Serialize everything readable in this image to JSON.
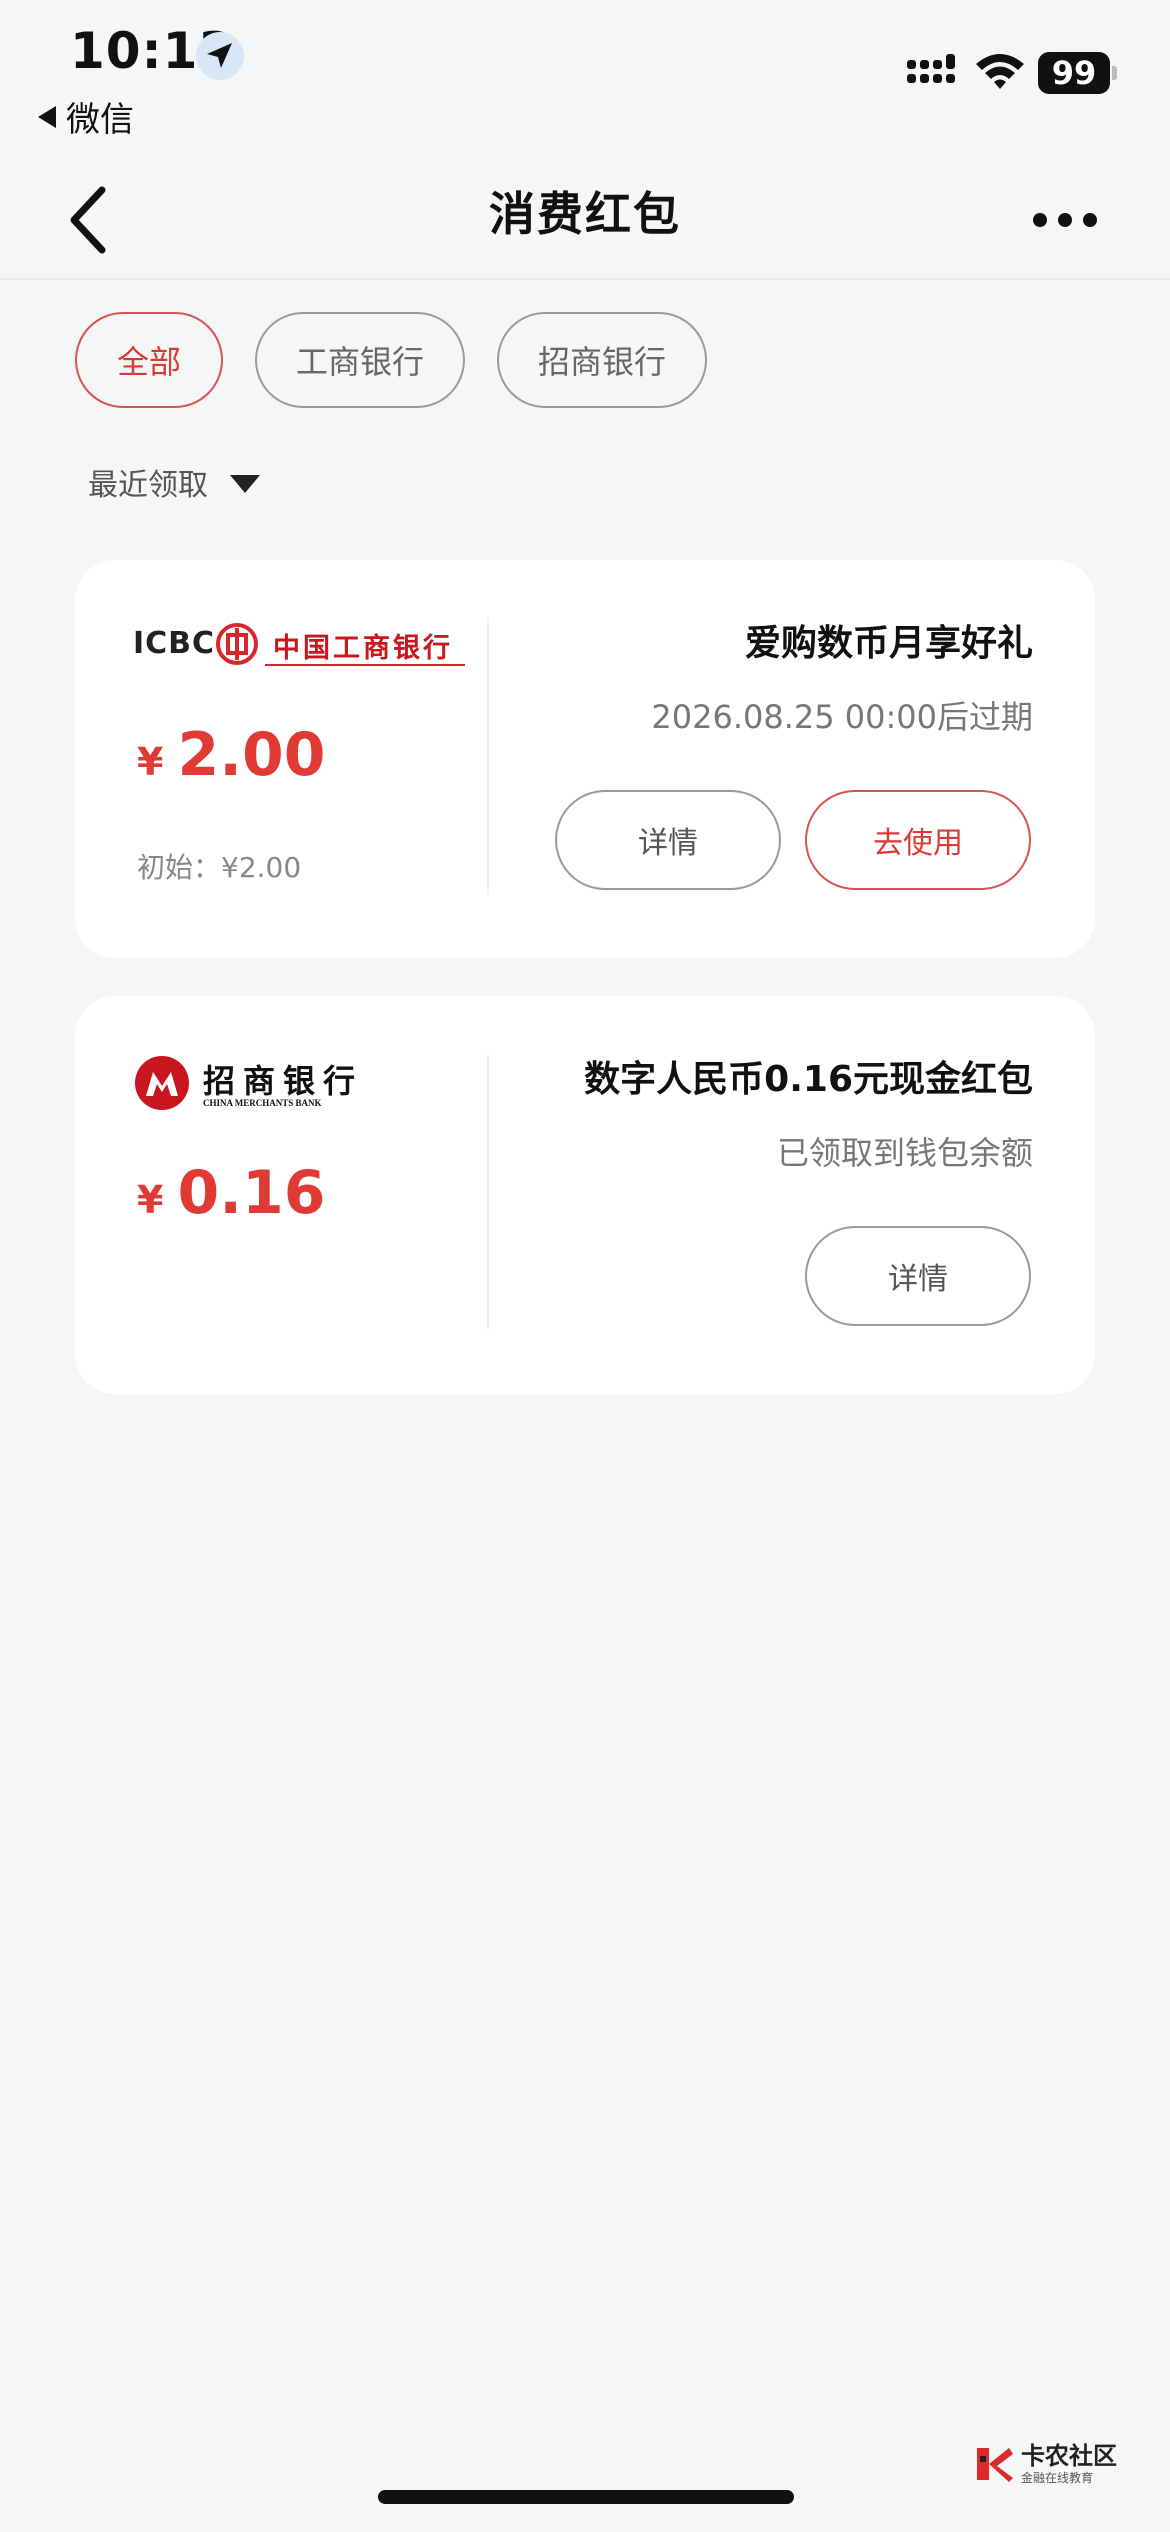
{
  "status_bar": {
    "time": "10:13",
    "back_app": "微信",
    "battery": "99"
  },
  "nav": {
    "title": "消费红包"
  },
  "filters": {
    "chips": [
      "全部",
      "工商银行",
      "招商银行"
    ],
    "selected": "全部"
  },
  "sort": {
    "label": "最近领取"
  },
  "cards": [
    {
      "bank": "中国工商银行",
      "bank_abbr": "ICBC",
      "currency": "¥",
      "amount": "2.00",
      "initial": "初始：¥2.00",
      "title": "爱购数币月享好礼",
      "subtitle": "2026.08.25 00:00后过期",
      "buttons": [
        "详情",
        "去使用"
      ]
    },
    {
      "bank": "招商银行",
      "bank_en": "CHINA MERCHANTS BANK",
      "currency": "¥",
      "amount": "0.16",
      "title": "数字人民币0.16元现金红包",
      "subtitle": "已领取到钱包余额",
      "buttons": [
        "详情"
      ]
    }
  ],
  "watermark": {
    "main": "卡农社区",
    "sub": "金融在线教育"
  },
  "colors": {
    "accent": "#e03a35",
    "background": "#f5f6f8"
  }
}
